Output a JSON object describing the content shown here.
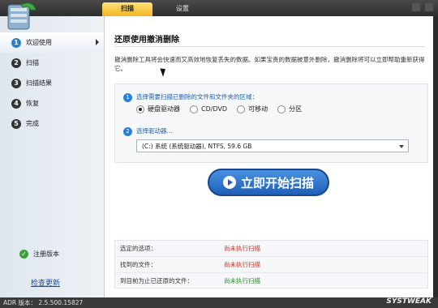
{
  "header": {
    "tabs": [
      {
        "label": "扫描"
      },
      {
        "label": "设置"
      }
    ]
  },
  "sidebar": {
    "items": [
      {
        "num": "1",
        "label": "欢迎使用"
      },
      {
        "num": "2",
        "label": "扫描"
      },
      {
        "num": "3",
        "label": "扫描结果"
      },
      {
        "num": "4",
        "label": "恢复"
      },
      {
        "num": "5",
        "label": "完成"
      }
    ],
    "register_label": "注册版本",
    "update_link": "检查更新"
  },
  "main": {
    "title": "还原使用撤消删除",
    "description": "撤消删除工具将会快速而又高效地恢复丢失的数据。如果宝贵的数据被意外删除，撤消删除将可以立即帮助重新获得它。",
    "step1": {
      "num": "1",
      "label": "选择需要扫描已删除的文件和文件夹的区域："
    },
    "radio_options": [
      {
        "label": "硬盘驱动器",
        "selected": true
      },
      {
        "label": "CD/DVD",
        "selected": false
      },
      {
        "label": "可移动",
        "selected": false
      },
      {
        "label": "分区",
        "selected": false
      }
    ],
    "step2": {
      "num": "2",
      "label": "选择驱动器..."
    },
    "drive_select": "(C:) 系统 (系统驱动器), NTFS, 59.6 GB",
    "scan_button": "立即开始扫描",
    "status": [
      {
        "label": "选定的选项：",
        "value": "尚未执行扫描",
        "color": "#c0392b"
      },
      {
        "label": "找到的文件：",
        "value": "尚未执行扫描",
        "color": "#c0392b"
      },
      {
        "label": "到目前为止已还原的文件：",
        "value": "尚未执行扫描",
        "color": "#2e8b2e"
      }
    ]
  },
  "footer": {
    "version": "ADR 版本： 2.5.500.15827",
    "brand": "SYSTWEAK"
  }
}
